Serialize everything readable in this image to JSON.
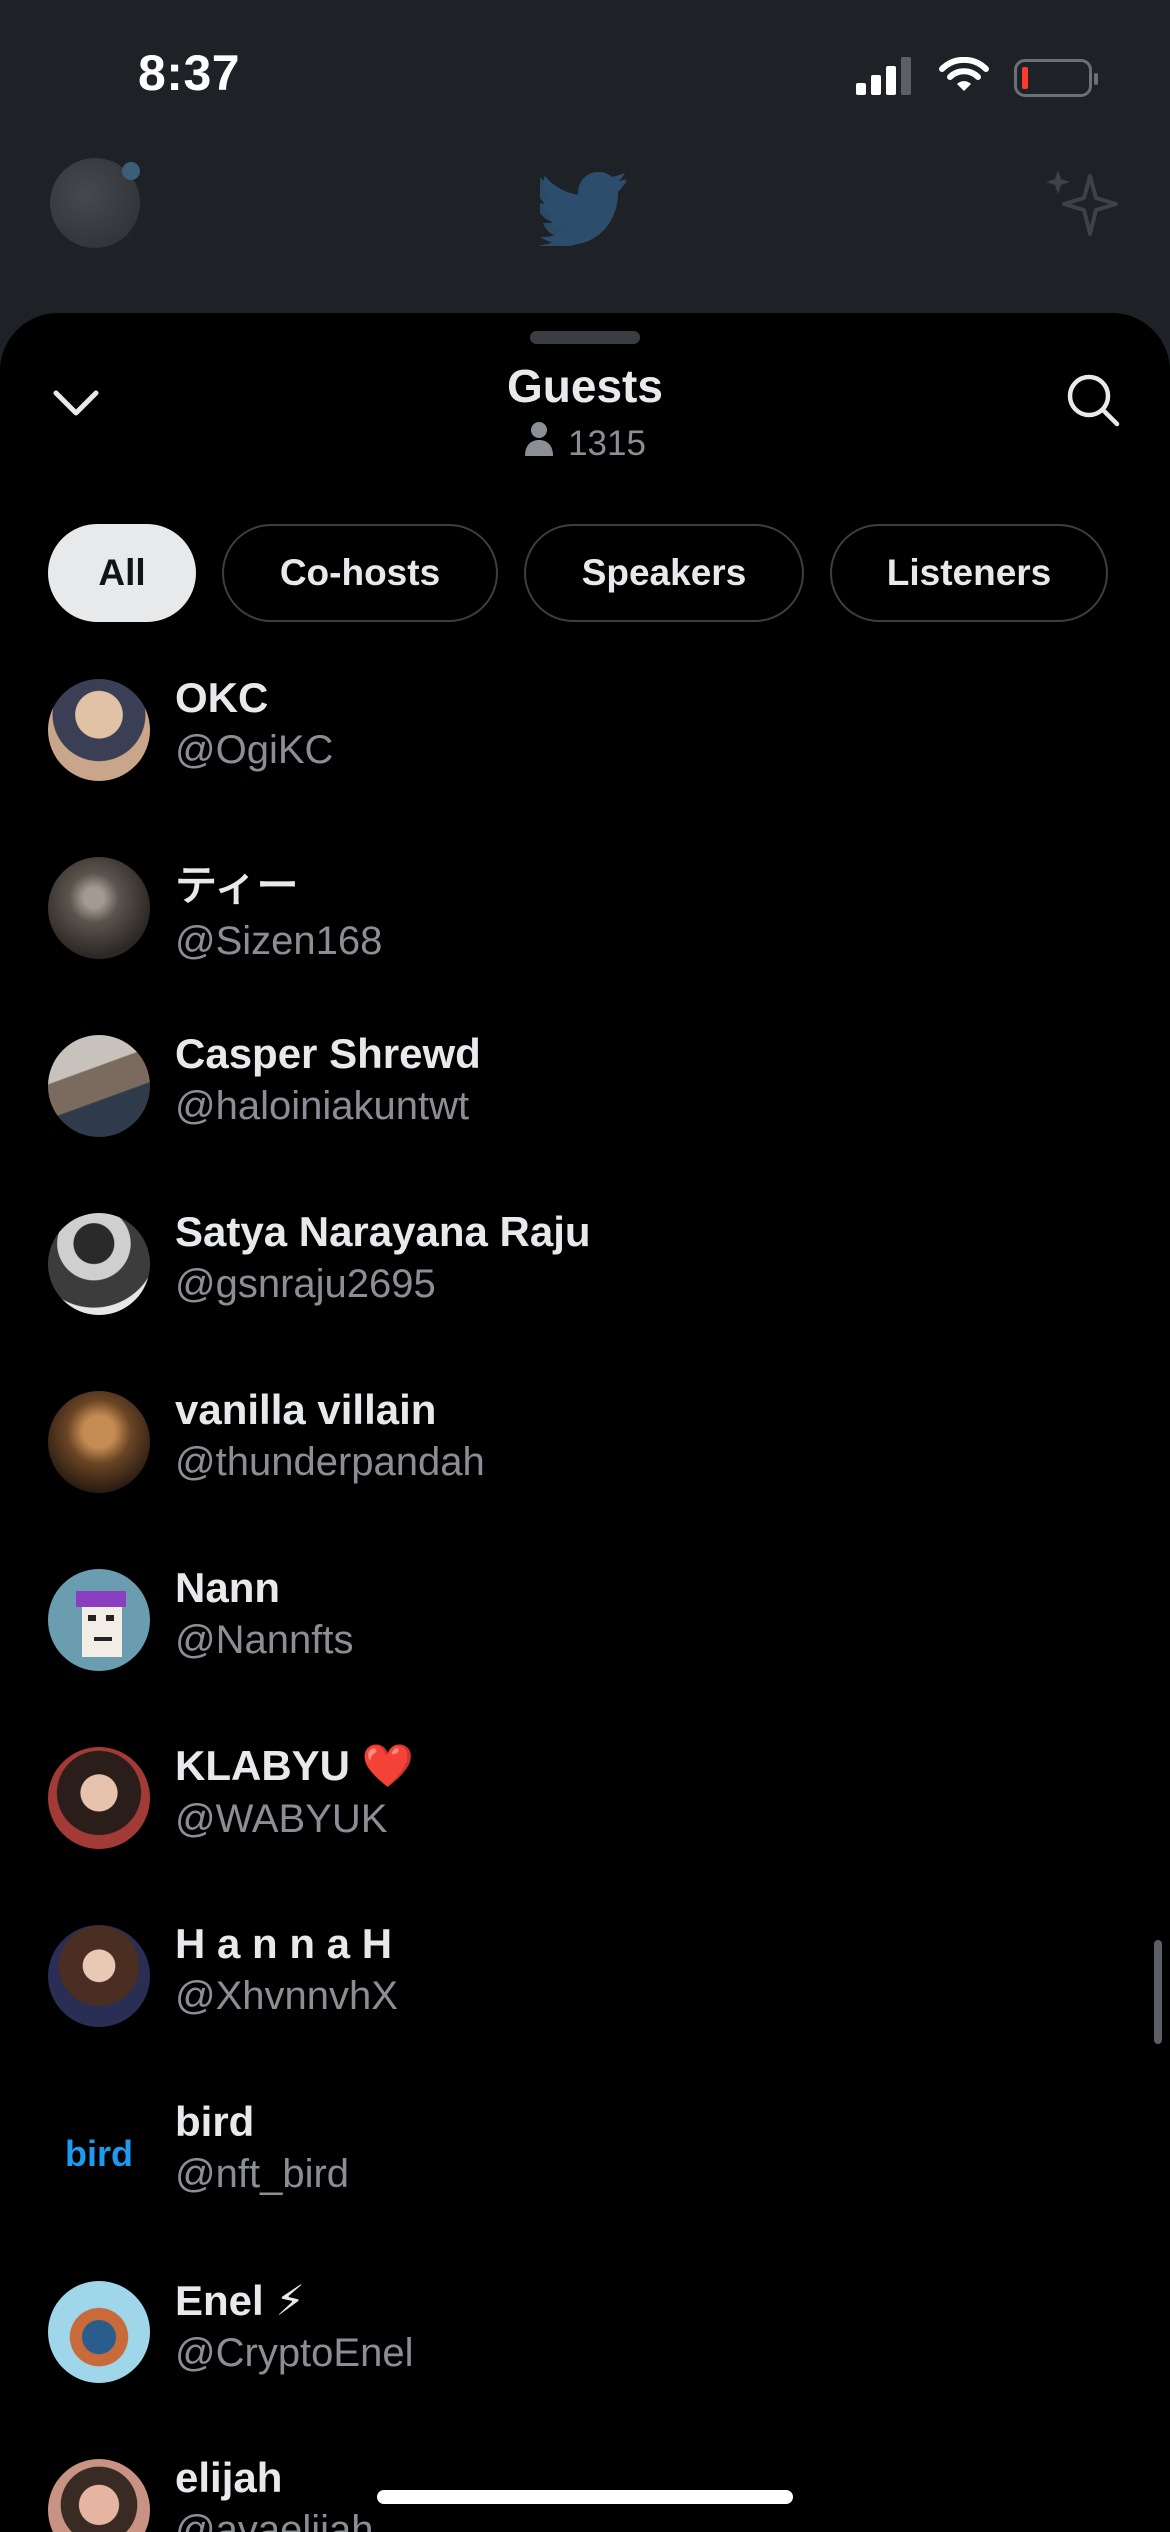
{
  "status_bar": {
    "time": "8:37",
    "icons": [
      "cellular-signal-icon",
      "wifi-icon",
      "battery-low-icon"
    ]
  },
  "background_header": {
    "icons": [
      "avatar",
      "twitter-bird-icon",
      "sparkle-icon"
    ]
  },
  "sheet": {
    "title": "Guests",
    "guest_count": "1315",
    "icons": [
      "chevron-down-icon",
      "search-icon",
      "person-icon"
    ]
  },
  "filters": [
    {
      "label": "All",
      "active": true
    },
    {
      "label": "Co-hosts",
      "active": false
    },
    {
      "label": "Speakers",
      "active": false
    },
    {
      "label": "Listeners",
      "active": false
    }
  ],
  "guests": [
    {
      "name": "OKC",
      "handle": "@OgiKC",
      "avatar_color": "#c9a68a"
    },
    {
      "name": "ティー",
      "handle": "@Sizen168",
      "avatar_color": "#6e6660"
    },
    {
      "name": "Casper Shrewd",
      "handle": "@haloiniakuntwt",
      "avatar_color": "#7a6b5e"
    },
    {
      "name": "Satya Narayana Raju",
      "handle": "@gsnraju2695",
      "avatar_color": "#9a9a9a"
    },
    {
      "name": "vanilla villain",
      "handle": "@thunderpandah",
      "avatar_color": "#8a5a2b"
    },
    {
      "name": "Nann",
      "handle": "@Nannfts",
      "avatar_color": "#5f8fa3"
    },
    {
      "name": "KLABYU ❤️",
      "handle": "@WABYUK",
      "avatar_color": "#5a3a36"
    },
    {
      "name": "H a n n a H",
      "handle": "@XhvnnvhX",
      "avatar_color": "#2a2e55"
    },
    {
      "name": "bird",
      "handle": "@nft_bird",
      "avatar_text": "bird",
      "avatar_color": "#000000"
    },
    {
      "name": "Enel ⚡",
      "handle": "@CryptoEnel",
      "avatar_color": "#7bc6e0"
    },
    {
      "name": "elijah",
      "handle": "@avaelijah",
      "avatar_color": "#d9a090"
    }
  ],
  "colors": {
    "sheet_bg": "#000000",
    "app_bg_dimmed": "#1e2126",
    "primary_text": "#e7e9ea",
    "secondary_text": "#8b8f95",
    "active_chip": "#e7e9ea",
    "bird_avatar_text": "#1d9bf0",
    "battery_low": "#ff3b30"
  }
}
